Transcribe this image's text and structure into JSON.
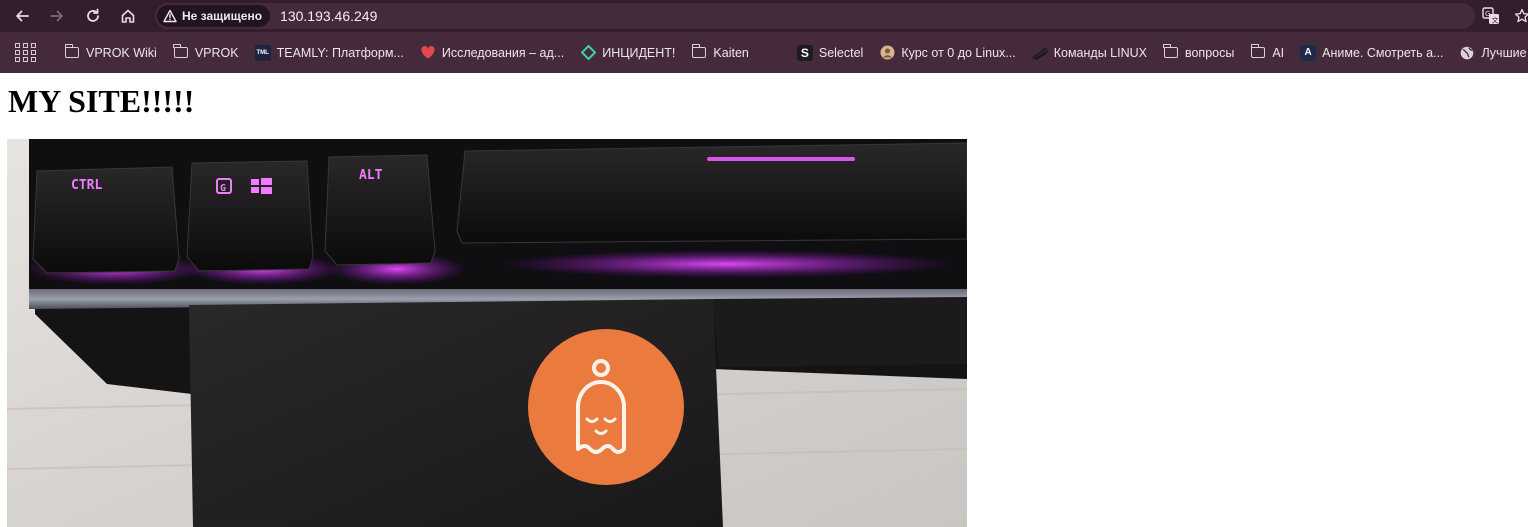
{
  "browser": {
    "security_label": "Не защищено",
    "url": "130.193.46.249",
    "icons": {
      "back": "arrow-left-icon",
      "forward": "arrow-right-icon",
      "reload": "reload-icon",
      "home": "home-icon",
      "translate": "translate-icon",
      "bookmark": "star-icon"
    },
    "theme": {
      "toolbar": "#331e2d",
      "bookmarks_bar": "#452a3c"
    }
  },
  "bookmarks": [
    {
      "label": "VPROK Wiki",
      "icon": "folder-icon"
    },
    {
      "label": "VPROK",
      "icon": "folder-icon"
    },
    {
      "label": "TEAMLY: Платформ...",
      "icon": "teamly-icon",
      "icon_text": "TML"
    },
    {
      "label": "Исследования – ад...",
      "icon": "heart-icon"
    },
    {
      "label": "ИНЦИДЕНТ!",
      "icon": "diamond-icon"
    },
    {
      "label": "Kaiten",
      "icon": "folder-icon"
    },
    {
      "label": "",
      "icon": "crescent-icon"
    },
    {
      "label": "Selectel",
      "icon": "selectel-icon",
      "icon_text": "S"
    },
    {
      "label": "Курс от 0 до Linux...",
      "icon": "avatar-icon"
    },
    {
      "label": "Команды LINUX",
      "icon": "penguin-icon"
    },
    {
      "label": "вопросы",
      "icon": "folder-icon"
    },
    {
      "label": "AI",
      "icon": "folder-icon"
    },
    {
      "label": "Аниме. Смотреть а...",
      "icon": "anime-icon",
      "icon_text": "A"
    },
    {
      "label": "Лучшие онлай",
      "icon": "globe-icon"
    }
  ],
  "page": {
    "heading": "MY SITE!!!!!",
    "image": {
      "description_icon": "keyboard-photo",
      "keycaps": [
        "CTRL",
        "G",
        "ALT"
      ],
      "sticker_icon": "ghost-sticker-icon",
      "colors": {
        "sticker": "#ea7a3e",
        "backlight": "#c21ef0",
        "keys": "#141214"
      }
    }
  }
}
